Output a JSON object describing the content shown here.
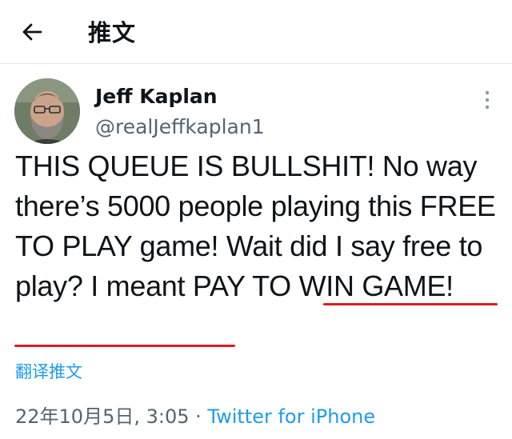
{
  "topbar": {
    "back_icon": "arrow-left-icon",
    "title": "推文"
  },
  "author": {
    "avatar_icon": "profile-photo",
    "name": "Jeff Kaplan",
    "handle": "@realJeffkaplan1",
    "more_icon": "more-vertical-icon"
  },
  "tweet": {
    "text_part1": "THIS QUEUE IS BULLSHIT! No way there’s 5000 people playing this FREE TO PLAY game! Wait did I say free to play? ",
    "text_highlight": "I meant PAY TO WIN GAME!",
    "translate_label": "翻译推文"
  },
  "meta": {
    "timestamp": "22年10月5日, 3:05",
    "separator": " · ",
    "source": "Twitter for iPhone"
  },
  "colors": {
    "link": "#1d9bf0",
    "secondary_text": "#536471",
    "annotation_underline": "#d61f1f"
  }
}
